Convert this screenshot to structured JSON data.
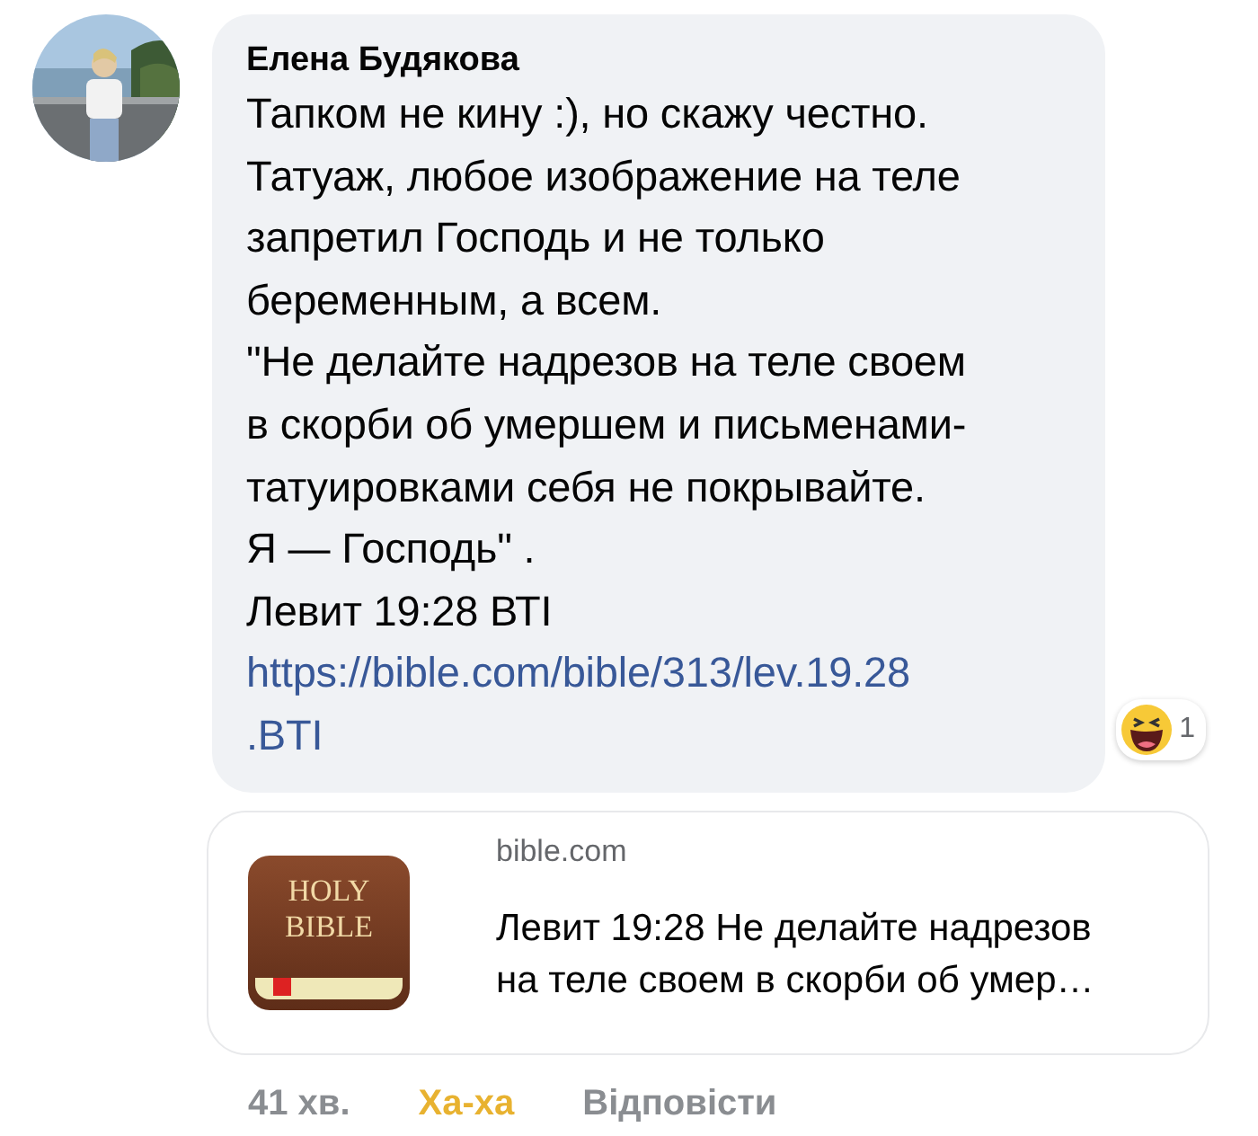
{
  "comment": {
    "avatar": {
      "kind": "picture"
    },
    "author": "Елена Будякова",
    "lines": [
      "Тапком не кину :), но скажу честно.",
      "Татуаж, любое изображение на теле",
      "запретил Господь и не только",
      "беременным, а всем.",
      "\"Не делайте надрезов на теле своем",
      "в скорби об умершем и письменами-",
      "татуировками себя не покрывайте.",
      "Я — Господь\" .",
      "Левит 19:28 ВТІ"
    ],
    "link_lines": [
      "https://bible.com/bible/313/lev.19.28",
      ".BTI"
    ],
    "reaction": {
      "count": "1"
    },
    "preview": {
      "logo_lines": [
        "HOLY",
        "BIBLE"
      ],
      "domain": "bible.com",
      "title_lines": [
        "Левит 19:28 Не делайте надрезов",
        "на теле своем в скорби об умер…"
      ]
    },
    "actions": [
      {
        "kind": "time",
        "label": "41 хв."
      },
      {
        "kind": "reacted",
        "label": "Ха-ха"
      },
      {
        "kind": "reply",
        "label": "Відповісти"
      }
    ]
  }
}
